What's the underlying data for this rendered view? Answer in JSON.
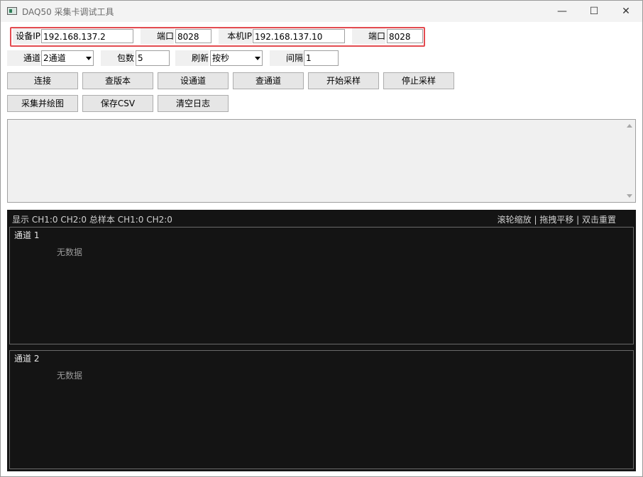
{
  "window": {
    "title": "DAQ50 采集卡调试工具",
    "controls": {
      "minimize": "—",
      "maximize": "☐",
      "close": "✕"
    }
  },
  "network": {
    "device_ip_label": "设备IP",
    "device_ip": "192.168.137.2",
    "device_port_label": "端口",
    "device_port": "8028",
    "local_ip_label": "本机IP",
    "local_ip": "192.168.137.10",
    "local_port_label": "端口",
    "local_port": "8028"
  },
  "settings": {
    "channel_label": "通道",
    "channel_value": "2通道",
    "packets_label": "包数",
    "packets_value": "5",
    "refresh_label": "刷新",
    "refresh_value": "按秒",
    "interval_label": "间隔",
    "interval_value": "1"
  },
  "buttons": {
    "connect": "连接",
    "query_version": "查版本",
    "set_channel": "设通道",
    "query_channel": "查通道",
    "start_sampling": "开始采样",
    "stop_sampling": "停止采样",
    "sample_plot": "采集并绘图",
    "save_csv": "保存CSV",
    "clear_log": "清空日志"
  },
  "plot": {
    "status_left": "显示 CH1:0  CH2:0  总样本 CH1:0  CH2:0",
    "status_right": "滚轮缩放 | 拖拽平移 | 双击重置",
    "channels": [
      {
        "title": "通道 1",
        "empty_text": "无数据"
      },
      {
        "title": "通道 2",
        "empty_text": "无数据"
      }
    ]
  },
  "colors": {
    "highlight_border": "#e34b50",
    "plot_background": "#141414"
  }
}
